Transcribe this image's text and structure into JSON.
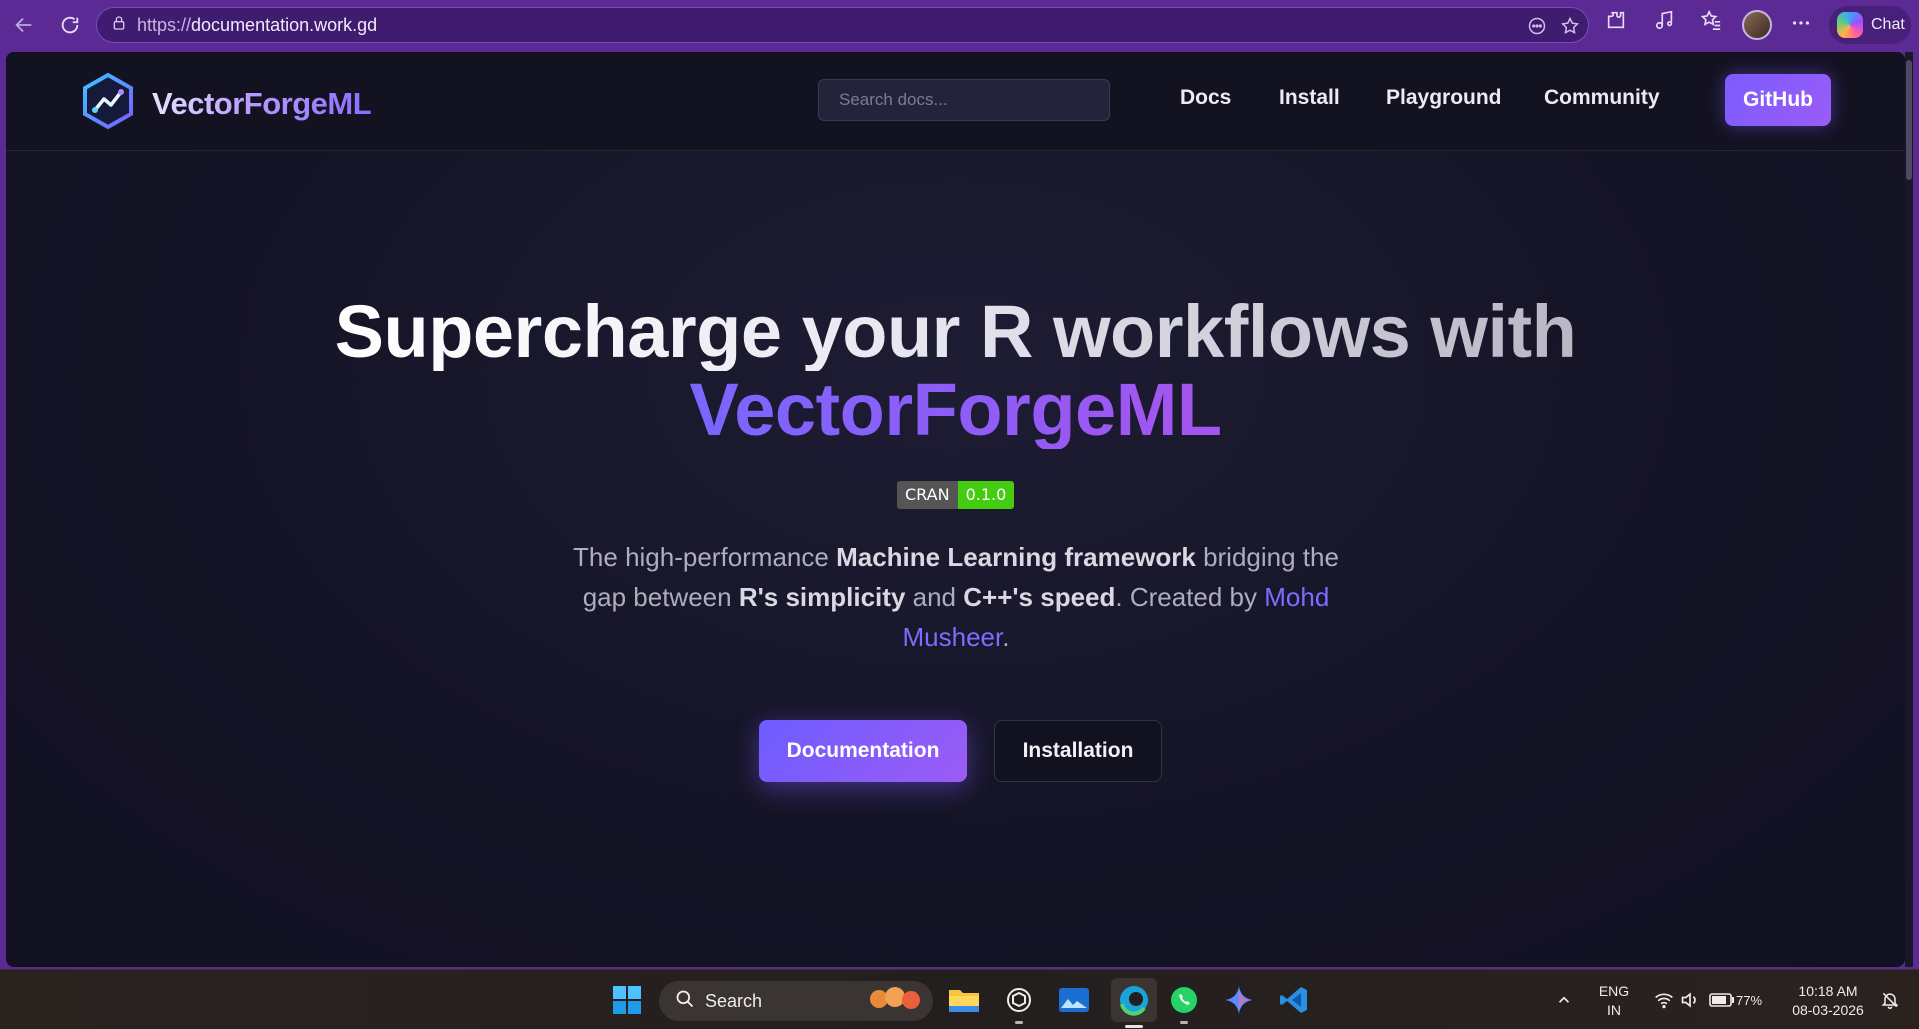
{
  "browser": {
    "url_protocol": "https://",
    "url_host": "documentation.work.gd",
    "chat_label": "Chat"
  },
  "site": {
    "brand_name": "VectorForgeML",
    "search_placeholder": "Search docs...",
    "nav": {
      "docs": "Docs",
      "install": "Install",
      "playground": "Playground",
      "community": "Community"
    },
    "github_label": "GitHub"
  },
  "hero": {
    "title_line1": "Supercharge your R workflows with",
    "title_line2": "VectorForgeML",
    "badge_label": "CRAN",
    "badge_version": "0.1.0",
    "desc_part1": "The high-performance ",
    "desc_bold1": "Machine Learning framework",
    "desc_part2": " bridging the gap between ",
    "desc_bold2": "R's simplicity",
    "desc_part3": " and ",
    "desc_bold3": "C++'s speed",
    "desc_part4": ". Created by ",
    "author": "Mohd Musheer",
    "desc_part5": ".",
    "primary_button": "Documentation",
    "secondary_button": "Installation"
  },
  "taskbar": {
    "search_label": "Search",
    "language_line1": "ENG",
    "language_line2": "IN",
    "battery": "77%",
    "time": "10:18 AM",
    "date": "08-03-2026"
  },
  "colors": {
    "browser_accent": "#5b2a95",
    "brand_accent": "#7c5cff",
    "page_background": "#151426"
  }
}
